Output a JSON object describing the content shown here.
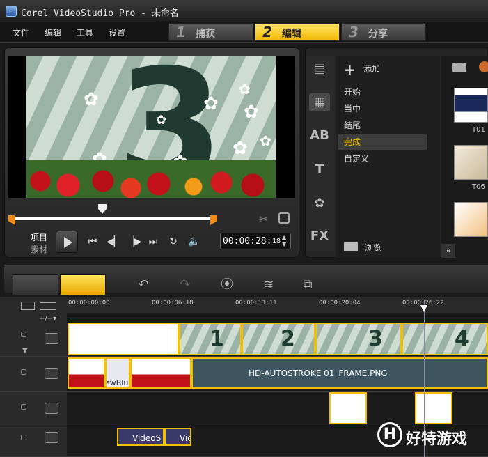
{
  "app": {
    "title": "Corel VideoStudio Pro - 未命名"
  },
  "menu": {
    "items": [
      "文件",
      "编辑",
      "工具",
      "设置"
    ]
  },
  "steps": [
    {
      "num": "1",
      "label": "捕获"
    },
    {
      "num": "2",
      "label": "编辑",
      "active": true
    },
    {
      "num": "3",
      "label": "分享"
    }
  ],
  "preview": {
    "mode_project": "项目",
    "mode_clip": "素材",
    "timecode": "00:00:28:",
    "timecode_frames": "18"
  },
  "library": {
    "add_label": "添加",
    "categories": [
      "开始",
      "当中",
      "结尾",
      "完成",
      "自定义"
    ],
    "selected_category": "完成",
    "browse_label": "浏览",
    "tab_icons": [
      "video-library-icon",
      "title-icon",
      "ab-transition-icon",
      "text-icon",
      "graphics-icon",
      "fx-icon"
    ],
    "fx_label": "FX",
    "thumbnails": [
      {
        "label": "T01"
      },
      {
        "label": "T06"
      },
      {
        "label": ""
      }
    ]
  },
  "timeline": {
    "ticks": [
      "00:00:00:00",
      "00:00:06:18",
      "00:00:13:11",
      "00:00:20:04",
      "00:00:26:22"
    ],
    "overlay_clip_label": "HD-AUTOSTROKE 01_FRAME.PNG",
    "title_clips": [
      "VideoS",
      "Vic"
    ],
    "title_clip_partial": "ewBlu",
    "video_numbers": [
      "1",
      "2",
      "3",
      "4"
    ]
  },
  "watermark": {
    "logo_letter": "H",
    "text": "好特游戏"
  }
}
